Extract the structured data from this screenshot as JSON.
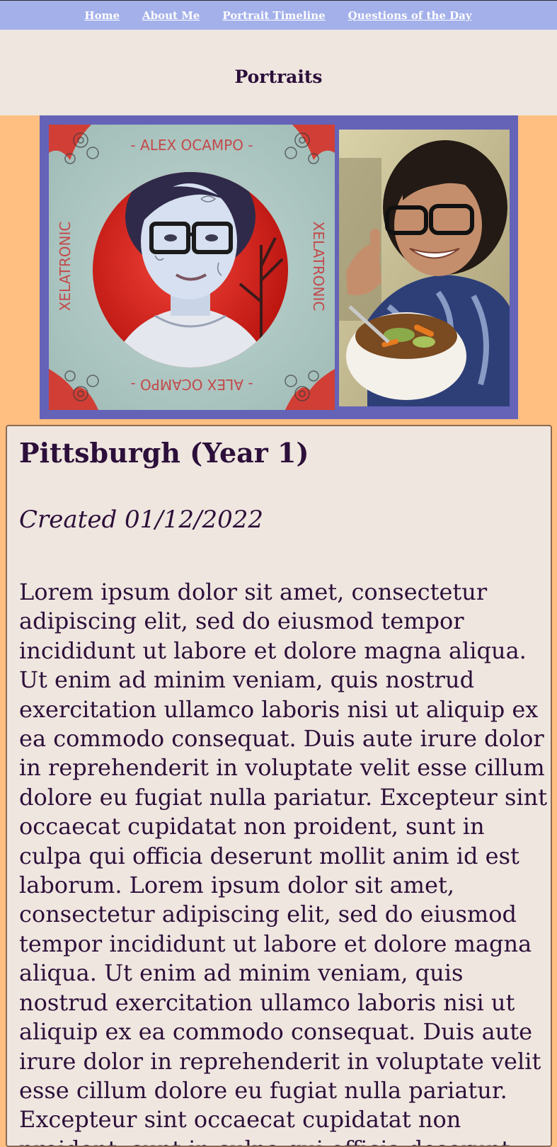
{
  "nav": {
    "links": [
      "Home",
      "About Me",
      "Portrait Timeline",
      "Questions of the Day"
    ]
  },
  "header": {
    "title": "Portraits"
  },
  "portraits": {
    "artwork_caption_top": "- ALEX OCAMPO -",
    "artwork_caption_side": "XELATRONIC",
    "colors": {
      "frame": "#6463B7",
      "art_background": "#A9C4C0",
      "accent_red": "#D9281E"
    }
  },
  "entry": {
    "title": "Pittsburgh (Year 1)",
    "created": "Created 01/12/2022",
    "body": "Lorem ipsum dolor sit amet, consectetur adipiscing elit, sed do eiusmod tempor incididunt ut labore et dolore magna aliqua. Ut enim ad minim veniam, quis nostrud exercitation ullamco laboris nisi ut aliquip ex ea commodo consequat. Duis aute irure dolor in reprehenderit in voluptate velit esse cillum dolore eu fugiat nulla pariatur. Excepteur sint occaecat cupidatat non proident, sunt in culpa qui officia deserunt mollit anim id est laborum. Lorem ipsum dolor sit amet, consectetur adipiscing elit, sed do eiusmod tempor incididunt ut labore et dolore magna aliqua. Ut enim ad minim veniam, quis nostrud exercitation ullamco laboris nisi ut aliquip ex ea commodo consequat. Duis aute irure dolor in reprehenderit in voluptate velit esse cillum dolore eu fugiat nulla pariatur. Excepteur sint occaecat cupidatat non proident, sunt in culpa qui officia deserunt mollit anim id est laborum."
  },
  "colors": {
    "navbar": "#A3B0EA",
    "title_band": "#EFE6DF",
    "page_background": "#FFBF80",
    "text": "#2c0f3a"
  }
}
